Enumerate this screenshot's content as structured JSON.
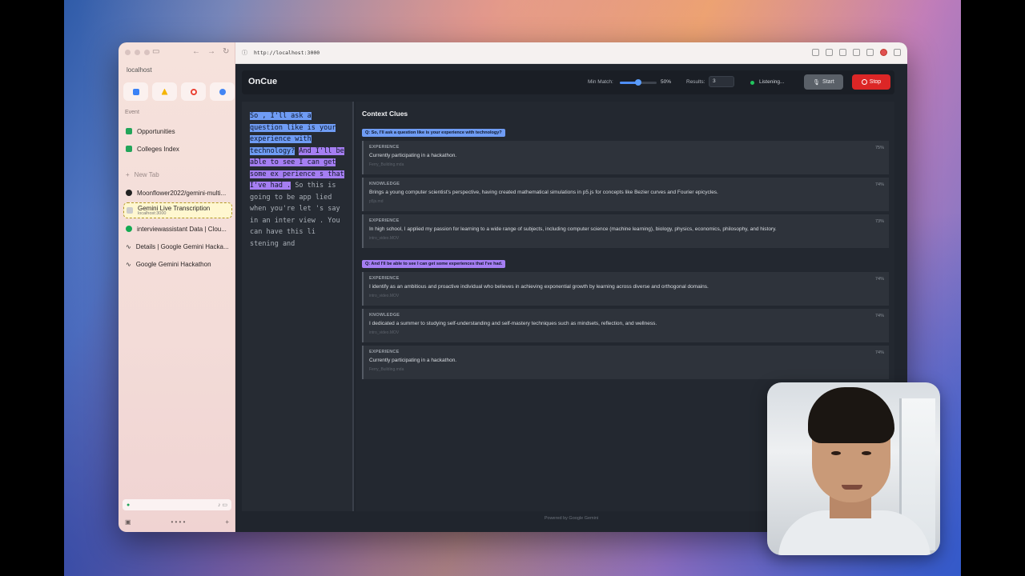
{
  "sidebar": {
    "address": "localhost",
    "section_label": "Event",
    "pinned": [
      {
        "label": "Opportunities",
        "color": "#22a55a"
      },
      {
        "label": "Colleges Index",
        "color": "#22a55a"
      }
    ],
    "new_tab": "New Tab",
    "tabs": [
      {
        "label": "Moonflower2022/gemini-multi...",
        "icon": "github-icon"
      },
      {
        "label": "Gemini Live Transcription",
        "sub": "localhost:3000",
        "icon": "page-icon"
      },
      {
        "label": "interviewassistant Data | Clou...",
        "icon": "mongodb-icon"
      },
      {
        "label": "Details | Google Gemini Hacka...",
        "icon": "devpost-icon"
      },
      {
        "label": "Google Gemini Hackathon",
        "icon": "devpost-icon"
      }
    ]
  },
  "browser": {
    "url": "http://localhost:3000"
  },
  "app": {
    "title": "OnCue",
    "min_match_label": "Min Match:",
    "min_match_value": 0.5,
    "min_match_text": "50%",
    "results_label": "Results:",
    "results_value": "3",
    "status": "Listening...",
    "start_label": "Start",
    "stop_label": "Stop",
    "transcript": {
      "q1": "So , I'll ask a question like is your experience with technology?",
      "q2": "And I'll be able to see I can get some ex perience s that I've had .",
      "rest": "So this is going to be app lied when you're let 's say in an inter view . You can have this li stening and"
    },
    "clues_title": "Context Clues",
    "groups": [
      {
        "question": "Q: So, I'll ask a question like is your experience with technology?",
        "cards": [
          {
            "type": "EXPERIENCE",
            "text": "Currently participating in a hackathon.",
            "source": "Ferry_Building.mda",
            "score": "75%"
          },
          {
            "type": "KNOWLEDGE",
            "text": "Brings a young computer scientist's perspective, having created mathematical simulations in p5.js for concepts like Bezier curves and Fourier epicycles.",
            "source": "p5js.md",
            "score": "74%"
          },
          {
            "type": "EXPERIENCE",
            "text": "In high school, I applied my passion for learning to a wide range of subjects, including computer science (machine learning), biology, physics, economics, philosophy, and history.",
            "source": "intro_video.MOV",
            "score": "73%"
          }
        ]
      },
      {
        "question": "Q: And I'll be able to see I can get some experiences that I've had.",
        "cards": [
          {
            "type": "EXPERIENCE",
            "text": "I identify as an ambitious and proactive individual who believes in achieving exponential growth by learning across diverse and orthogonal domains.",
            "source": "intro_video.MOV",
            "score": "74%"
          },
          {
            "type": "KNOWLEDGE",
            "text": "I dedicated a summer to studying self-understanding and self-mastery techniques such as mindsets, reflection, and wellness.",
            "source": "intro_video.MOV",
            "score": "74%"
          },
          {
            "type": "EXPERIENCE",
            "text": "Currently participating in a hackathon.",
            "source": "Ferry_Building.mda",
            "score": "74%"
          }
        ]
      }
    ],
    "footer": "Powered by Google Gemini"
  }
}
